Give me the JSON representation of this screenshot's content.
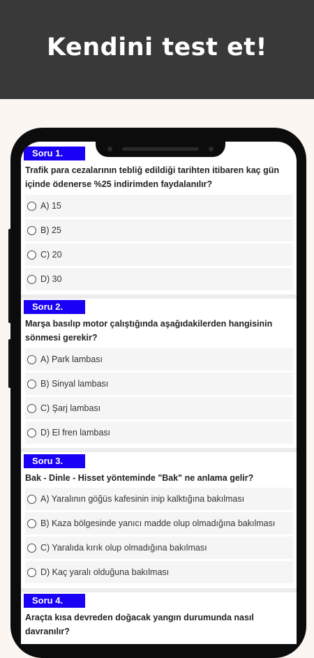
{
  "banner": {
    "title": "Kendini test et!"
  },
  "questions": [
    {
      "badge": "Soru 1.",
      "text": "Trafik para cezalarının tebliğ edildiği tarihten itibaren kaç gün içinde ödenerse %25 indirimden faydalanılır?",
      "options": [
        "A) 15",
        "B) 25",
        "C) 20",
        "D) 30"
      ]
    },
    {
      "badge": "Soru 2.",
      "text": "Marşa basılıp motor çalıştığında aşağıdakilerden hangisinin sönmesi gerekir?",
      "options": [
        "A) Park lambası",
        "B) Sinyal lambası",
        "C) Şarj lambası",
        "D) El fren lambası"
      ]
    },
    {
      "badge": "Soru 3.",
      "text": "Bak - Dinle - Hisset yönteminde \"Bak\" ne anlama gelir?",
      "options": [
        "A) Yaralının göğüs kafesinin inip kalktığına bakılması",
        "B) Kaza bölgesinde yanıcı madde olup olmadığına bakılması",
        "C) Yaralıda kırık olup olmadığına bakılması",
        "D) Kaç yaralı olduğuna bakılması"
      ]
    },
    {
      "badge": "Soru 4.",
      "text": "Araçta kısa devreden doğacak yangın durumunda nasıl davranılır?",
      "options": []
    }
  ]
}
